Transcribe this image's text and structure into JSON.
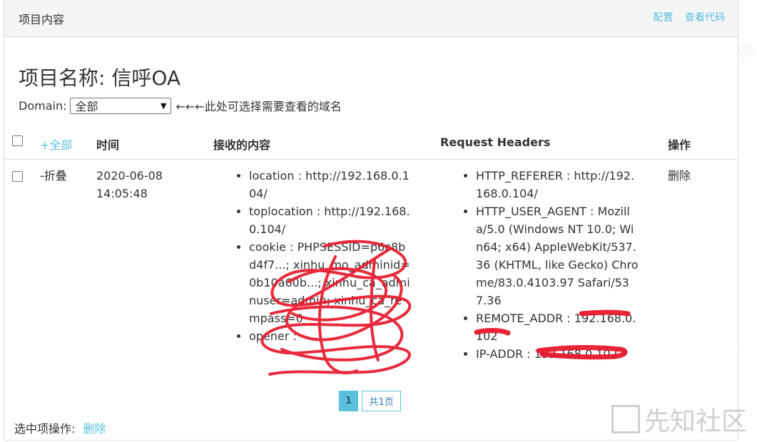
{
  "header": {
    "title": "项目内容",
    "links": [
      "配置",
      "查看代码"
    ]
  },
  "project": {
    "title": "项目名称: 信呼OA"
  },
  "domain": {
    "label": "Domain:",
    "selected": "全部",
    "hint": "←←←此处可选择需要查看的域名"
  },
  "table": {
    "columns": {
      "expand_all": "+全部",
      "time": "时间",
      "content": "接收的内容",
      "headers": "Request Headers",
      "action": "操作"
    },
    "rows": [
      {
        "toggle": "-折叠",
        "time": "2020-06-08 14:05:48",
        "content": [
          "location : http://192.168.0.104/",
          "toplocation : http://192.168.0.104/",
          "cookie : PHPSESSID=p6c8bd4f7...; xinhu_mo_adminid=0b10a60b...; xinhu_ca_adminuser=admin; xinhu_ca_rempass=0",
          "opener :"
        ],
        "headers": [
          "HTTP_REFERER : http://192.168.0.104/",
          "HTTP_USER_AGENT : Mozilla/5.0 (Windows NT 10.0; Win64; x64) AppleWebKit/537.36 (KHTML, like Gecko) Chrome/83.0.4103.97 Safari/537.36",
          "REMOTE_ADDR : 192.168.0.102",
          "IP-ADDR : 192.168.0.102"
        ],
        "action": "删除"
      }
    ]
  },
  "pagination": {
    "current": "1",
    "total": "共1页"
  },
  "footer": {
    "label": "选中项操作:",
    "action": "删除"
  },
  "watermark": {
    "text": "零组资料文库"
  },
  "corner_logo": {
    "text": "先知社区"
  },
  "colors": {
    "accent": "#5bc0de",
    "link": "#337ab7",
    "scribble": "#e8192c"
  }
}
